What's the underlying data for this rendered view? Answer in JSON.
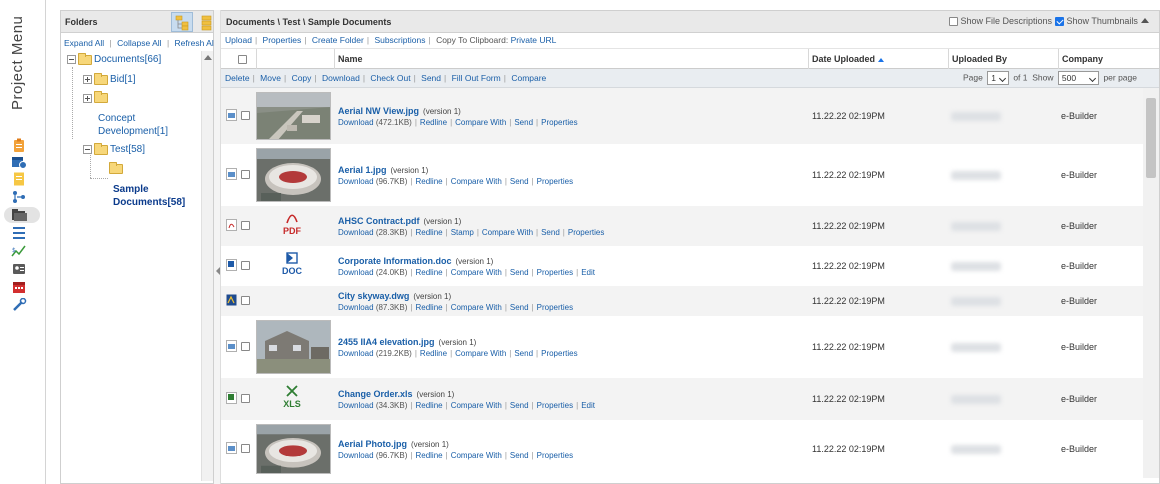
{
  "project_menu": {
    "label": "Project Menu",
    "icons": [
      "clipboard-icon",
      "calendar-clock-icon",
      "note-icon",
      "org-chart-icon",
      "folders-icon",
      "list-icon",
      "cash-chart-icon",
      "contacts-icon",
      "calendar-icon",
      "tools-icon"
    ]
  },
  "folders": {
    "title": "Folders",
    "actions": [
      "Expand All",
      "Collapse All",
      "Refresh All"
    ],
    "tree": {
      "root": "Documents[66]",
      "bid": "Bid[1]",
      "concept": "Concept Development[1]",
      "test": "Test[58]",
      "sample": "Sample Documents[58]"
    }
  },
  "header": {
    "path": "Documents \\ Test \\ Sample Documents",
    "show_descriptions": "Show File Descriptions",
    "show_thumbnails": "Show Thumbnails"
  },
  "toolbar_top": {
    "upload": "Upload",
    "properties": "Properties",
    "create_folder": "Create Folder",
    "subscriptions": "Subscriptions",
    "copy_label": "Copy To Clipboard:",
    "private_url": "Private URL"
  },
  "columns": {
    "name": "Name",
    "date": "Date Uploaded",
    "uploaded_by": "Uploaded By",
    "company": "Company"
  },
  "toolbar_actions": {
    "delete": "Delete",
    "move": "Move",
    "copy": "Copy",
    "download": "Download",
    "checkout": "Check Out",
    "send": "Send",
    "fillout": "Fill Out Form",
    "compare": "Compare"
  },
  "pager": {
    "page_label": "Page",
    "page": "1",
    "of": "of 1",
    "show_label": "Show",
    "per_page": "500",
    "per_page_label": "per page"
  },
  "rows": [
    {
      "name": "Aerial NW View.jpg",
      "version": "(version 1)",
      "size": "(472.1KB)",
      "actions": [
        "Download",
        "Redline",
        "Compare With",
        "Send",
        "Properties"
      ],
      "date": "11.22.22 02:19PM",
      "company": "e-Builder"
    },
    {
      "name": "Aerial 1.jpg",
      "version": "(version 1)",
      "size": "(96.7KB)",
      "actions": [
        "Download",
        "Redline",
        "Compare With",
        "Send",
        "Properties"
      ],
      "date": "11.22.22 02:19PM",
      "company": "e-Builder"
    },
    {
      "name": "AHSC Contract.pdf",
      "version": "(version 1)",
      "size": "(28.3KB)",
      "actions": [
        "Download",
        "Redline",
        "Stamp",
        "Compare With",
        "Send",
        "Properties"
      ],
      "date": "11.22.22 02:19PM",
      "company": "e-Builder",
      "icon_label": "PDF"
    },
    {
      "name": "Corporate Information.doc",
      "version": "(version 1)",
      "size": "(24.0KB)",
      "actions": [
        "Download",
        "Redline",
        "Compare With",
        "Send",
        "Properties",
        "Edit"
      ],
      "date": "11.22.22 02:19PM",
      "company": "e-Builder",
      "icon_label": "DOC"
    },
    {
      "name": "City skyway.dwg",
      "version": "(version 1)",
      "size": "(87.3KB)",
      "actions": [
        "Download",
        "Redline",
        "Compare With",
        "Send",
        "Properties"
      ],
      "date": "11.22.22 02:19PM",
      "company": "e-Builder"
    },
    {
      "name": "2455 IIA4 elevation.jpg",
      "version": "(version 1)",
      "size": "(219.2KB)",
      "actions": [
        "Download",
        "Redline",
        "Compare With",
        "Send",
        "Properties"
      ],
      "date": "11.22.22 02:19PM",
      "company": "e-Builder"
    },
    {
      "name": "Change Order.xls",
      "version": "(version 1)",
      "size": "(34.3KB)",
      "actions": [
        "Download",
        "Redline",
        "Compare With",
        "Send",
        "Properties",
        "Edit"
      ],
      "date": "11.22.22 02:19PM",
      "company": "e-Builder",
      "icon_label": "XLS"
    },
    {
      "name": "Aerial Photo.jpg",
      "version": "(version 1)",
      "size": "(96.7KB)",
      "actions": [
        "Download",
        "Redline",
        "Compare With",
        "Send",
        "Properties"
      ],
      "date": "11.22.22 02:19PM",
      "company": "e-Builder"
    }
  ],
  "colors": {
    "link": "#1a5fa8",
    "pdf": "#c62828",
    "doc": "#1e5aa8",
    "xls": "#2e7d32"
  }
}
